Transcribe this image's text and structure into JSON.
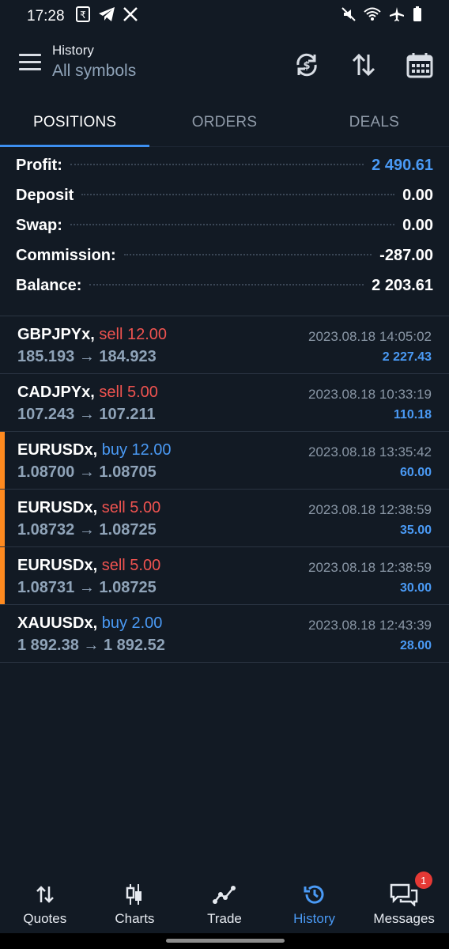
{
  "status": {
    "time": "17:28",
    "left_icons": [
      "rupee-icon",
      "telegram-icon",
      "x-icon"
    ],
    "right_icons": [
      "mute-icon",
      "wifi-icon",
      "airplane-icon",
      "battery-icon"
    ]
  },
  "header": {
    "title": "History",
    "subtitle": "All symbols",
    "icons": [
      "sync-currency-icon",
      "sort-icon",
      "calendar-icon"
    ]
  },
  "tabs": [
    {
      "label": "POSITIONS",
      "active": true
    },
    {
      "label": "ORDERS",
      "active": false
    },
    {
      "label": "DEALS",
      "active": false
    }
  ],
  "summary": [
    {
      "label": "Profit:",
      "value": "2 490.61"
    },
    {
      "label": "Deposit",
      "value": "0.00"
    },
    {
      "label": "Swap:",
      "value": "0.00"
    },
    {
      "label": "Commission:",
      "value": "-287.00"
    },
    {
      "label": "Balance:",
      "value": "2 203.61"
    }
  ],
  "trades": [
    {
      "symbol": "GBPJPYx,",
      "side": "sell 12.00",
      "prices": "185.193 → 184.923",
      "time": "2023.08.18 14:05:02",
      "profit": "2 227.43"
    },
    {
      "symbol": "CADJPYx,",
      "side": "sell 5.00",
      "prices": "107.243 → 107.211",
      "time": "2023.08.18 10:33:19",
      "profit": "110.18"
    },
    {
      "symbol": "EURUSDx,",
      "side": "buy 12.00",
      "prices": "1.08700 → 1.08705",
      "time": "2023.08.18 13:35:42",
      "profit": "60.00"
    },
    {
      "symbol": "EURUSDx,",
      "side": "sell 5.00",
      "prices": "1.08732 → 1.08725",
      "time": "2023.08.18 12:38:59",
      "profit": "35.00"
    },
    {
      "symbol": "EURUSDx,",
      "side": "sell 5.00",
      "prices": "1.08731 → 1.08725",
      "time": "2023.08.18 12:38:59",
      "profit": "30.00"
    },
    {
      "symbol": "XAUUSDx,",
      "side": "buy 2.00",
      "prices": "1 892.38 → 1 892.52",
      "time": "2023.08.18 12:43:39",
      "profit": "28.00"
    }
  ],
  "nav": [
    {
      "label": "Quotes",
      "icon": "quotes-icon"
    },
    {
      "label": "Charts",
      "icon": "charts-icon"
    },
    {
      "label": "Trade",
      "icon": "trade-icon"
    },
    {
      "label": "History",
      "icon": "history-icon"
    },
    {
      "label": "Messages",
      "icon": "messages-icon",
      "badge": "1"
    }
  ],
  "colors": {
    "background": "#121a24",
    "accent": "#4a9af5",
    "sell": "#ef5350",
    "buy": "#4a9af5",
    "marker": "#ff8a1f"
  }
}
